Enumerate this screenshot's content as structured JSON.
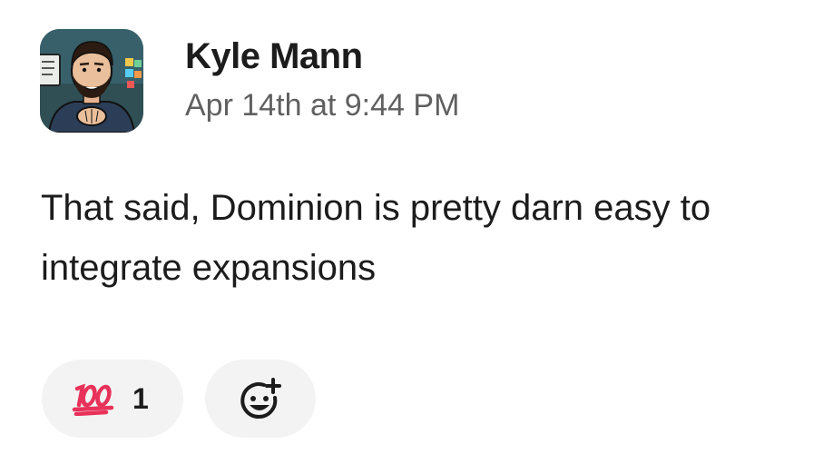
{
  "message": {
    "author": "Kyle Mann",
    "timestamp": "Apr 14th at 9:44 PM",
    "text": "That said, Dominion is pretty darn easy to integrate expansions",
    "avatar_icon": "user-avatar-illustration"
  },
  "reactions": [
    {
      "emoji_name": "100",
      "emoji_icon": "hundred-points-icon",
      "count": "1",
      "color": "#e8325a"
    }
  ],
  "add_reaction": {
    "icon": "add-reaction-icon"
  },
  "colors": {
    "text": "#1d1c1d",
    "muted": "#616061",
    "pill_bg": "#f3f3f3"
  }
}
